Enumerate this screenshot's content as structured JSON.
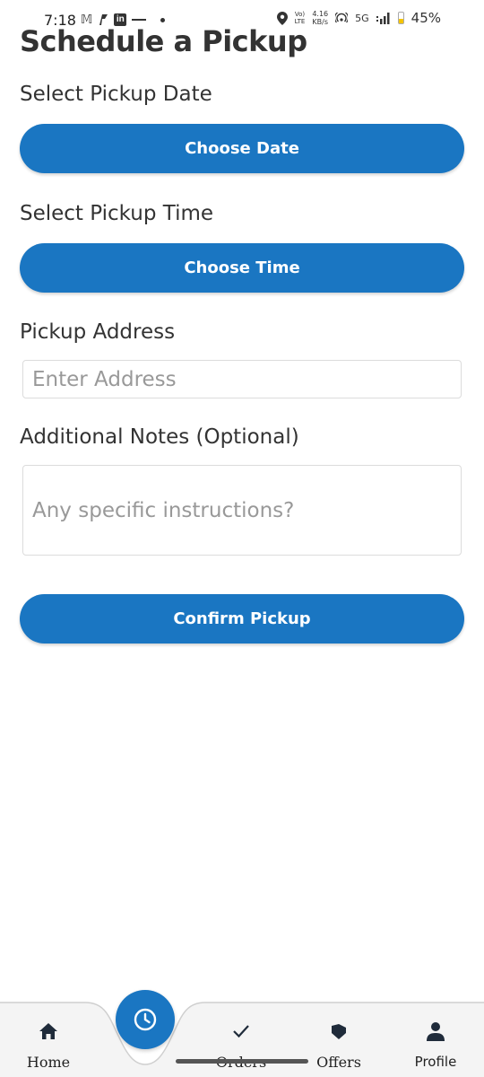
{
  "status_bar": {
    "time": "7:18",
    "network_top": "Vo)",
    "network_bottom": "LTE",
    "speed_value": "4.16",
    "speed_unit": "KB/s",
    "network_type": "5G",
    "battery_percent": "45%",
    "battery_level": 0.45,
    "icons": [
      "gmail-icon",
      "app-icon",
      "linkedin-icon",
      "location-icon",
      "hotspot-icon",
      "signal-icon",
      "battery-icon"
    ]
  },
  "page": {
    "title": "Schedule a Pickup"
  },
  "date_section": {
    "label": "Select Pickup Date",
    "button_label": "Choose Date"
  },
  "time_section": {
    "label": "Select Pickup Time",
    "button_label": "Choose Time"
  },
  "address_section": {
    "label": "Pickup Address",
    "placeholder": "Enter Address",
    "value": ""
  },
  "notes_section": {
    "label": "Additional Notes (Optional)",
    "placeholder": "Any specific instructions?",
    "value": ""
  },
  "confirm_button": {
    "label": "Confirm Pickup"
  },
  "bottom_nav": {
    "items": [
      {
        "label": "Home",
        "icon": "home-icon"
      },
      {
        "label": "",
        "icon": "clock-icon"
      },
      {
        "label": "Orders",
        "icon": "check-icon"
      },
      {
        "label": "Offers",
        "icon": "offer-tag-icon"
      },
      {
        "label": "Profile",
        "icon": "person-icon"
      }
    ]
  },
  "colors": {
    "primary": "#1a76c2",
    "text": "#333333",
    "placeholder": "#999999",
    "background": "#ffffff",
    "nav_background": "#f4f4f4"
  }
}
